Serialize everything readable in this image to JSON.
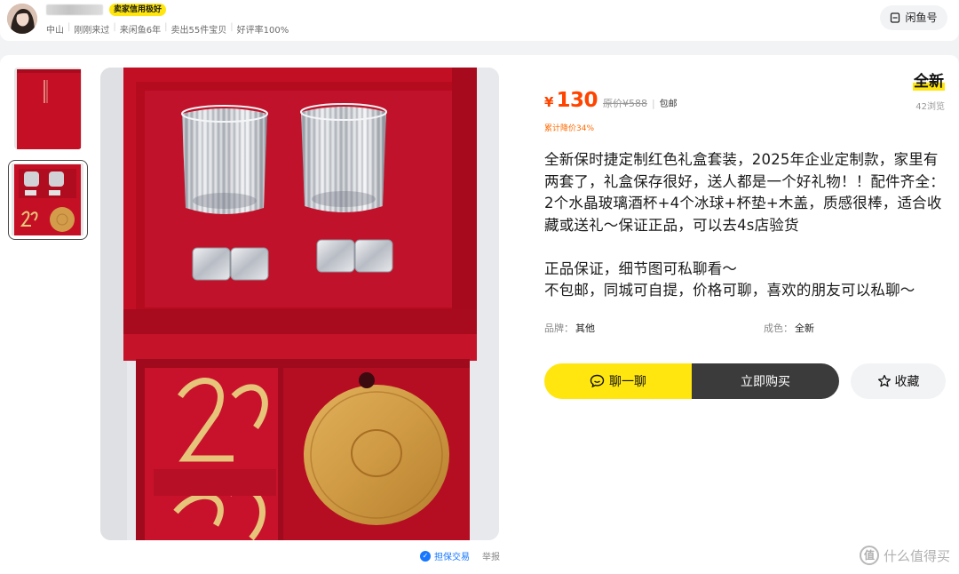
{
  "seller": {
    "credit_badge": "卖家信用极好",
    "stats": [
      "中山",
      "刚刚来过",
      "来闲鱼6年",
      "卖出55件宝贝",
      "好评率100%"
    ]
  },
  "header": {
    "xianyu_label": "闲鱼号"
  },
  "item": {
    "currency": "¥",
    "price": "130",
    "original_price": "原价¥588",
    "shipping": "包邮",
    "condition": "全新",
    "views": "42浏览",
    "discount": "累计降价34%",
    "description": "全新保时捷定制红色礼盒套装，2025年企业定制款，家里有两套了，礼盒保存很好，送人都是一个好礼物！！配件齐全：2个水晶玻璃酒杯+4个冰球+杯垫+木盖，质感很棒，适合收藏或送礼～保证正品，可以去4s店验货\n\n正品保证，细节图可私聊看～\n不包邮，同城可自提，价格可聊，喜欢的朋友可以私聊～",
    "attributes": {
      "brand_label": "品牌：",
      "brand_value": "其他",
      "condition_label": "成色：",
      "condition_value": "全新"
    }
  },
  "actions": {
    "chat": "聊一聊",
    "buy": "立即购买",
    "favorite": "收藏"
  },
  "footer": {
    "guarantee": "担保交易",
    "report": "举报",
    "watermark": "什么值得买"
  },
  "colors": {
    "accent_yellow": "#ffe60f",
    "price_orange": "#ff4400",
    "dark_button": "#3b3b3b",
    "box_red": "#c8102e"
  },
  "icons": [
    "chat-bubble-icon",
    "star-icon",
    "xianyu-id-icon",
    "guarantee-icon",
    "smzdm-logo-icon"
  ]
}
